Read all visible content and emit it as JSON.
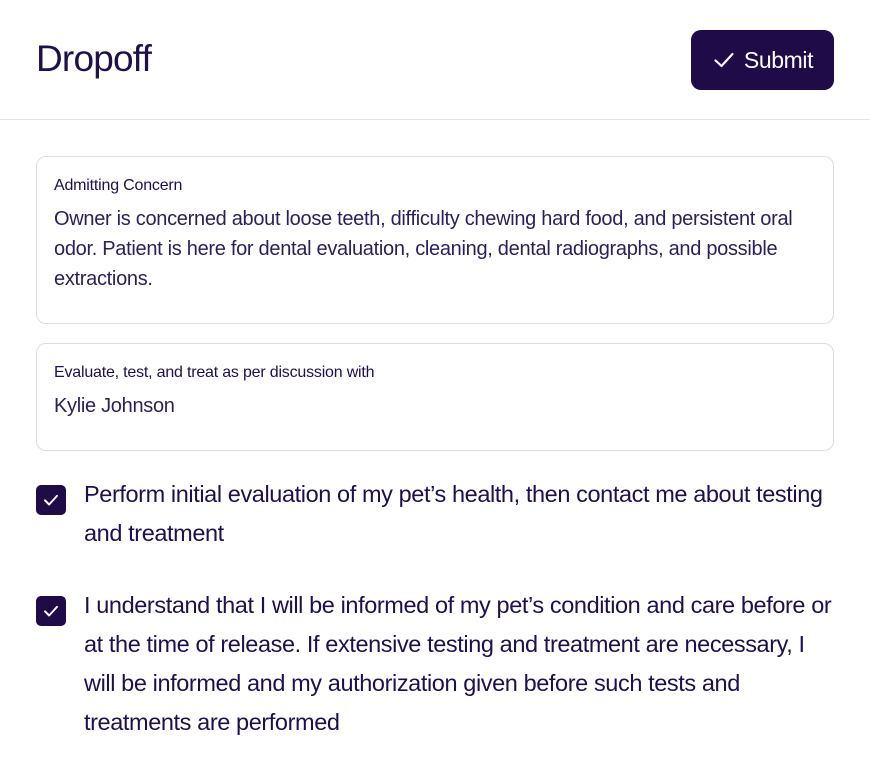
{
  "header": {
    "title": "Dropoff",
    "submit_label": "Submit",
    "submit_icon": "check-icon"
  },
  "admitting_concern": {
    "label": "Admitting Concern",
    "value": "Owner is concerned about loose teeth, difficulty chewing hard food, and persistent oral odor. Patient is here for dental evaluation, cleaning, dental radiographs, and possible extractions."
  },
  "discussion": {
    "label": "Evaluate, test, and treat as per discussion with",
    "value": "Kylie Johnson"
  },
  "consents": [
    {
      "checked": true,
      "text": "Perform initial evaluation of my pet’s health, then contact me about testing and treatment"
    },
    {
      "checked": true,
      "text": "I understand that I will be informed of my pet’s condition and care before or at the time of release. If extensive testing and treatment are necessary, I will be informed and my authorization given before such tests and treatments are performed"
    }
  ],
  "colors": {
    "primary": "#1e0b47",
    "text": "#1f0f4a",
    "border": "#dcdce6"
  }
}
